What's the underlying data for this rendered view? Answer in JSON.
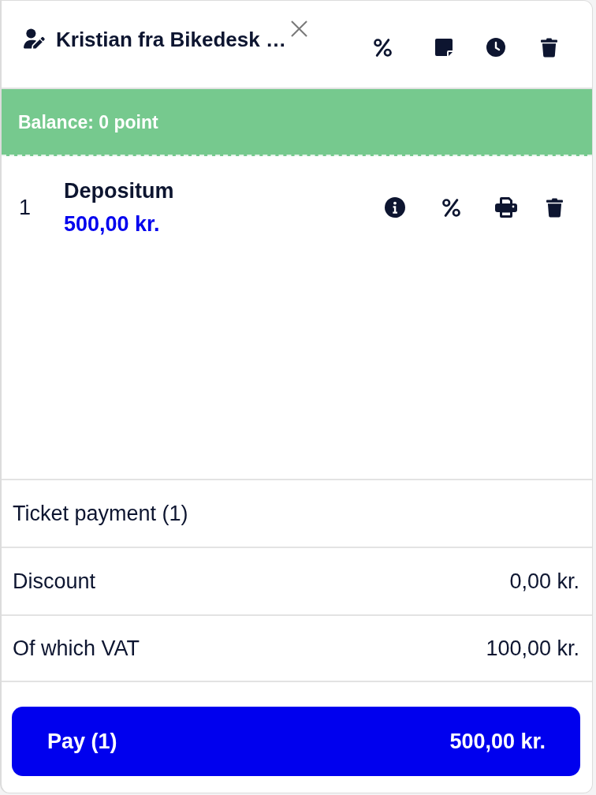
{
  "header": {
    "title": "Kristian fra Bikedesk …"
  },
  "balance": {
    "text": "Balance: 0 point"
  },
  "items": [
    {
      "number": "1",
      "name": "Depositum",
      "price": "500,00 kr."
    }
  ],
  "summary": [
    {
      "label": "Ticket payment (1)"
    },
    {
      "label": "Discount",
      "value": "0,00 kr."
    },
    {
      "label": "Of which VAT",
      "value": "100,00 kr."
    }
  ],
  "pay_button": {
    "label": "Pay (1)",
    "amount": "500,00 kr."
  }
}
